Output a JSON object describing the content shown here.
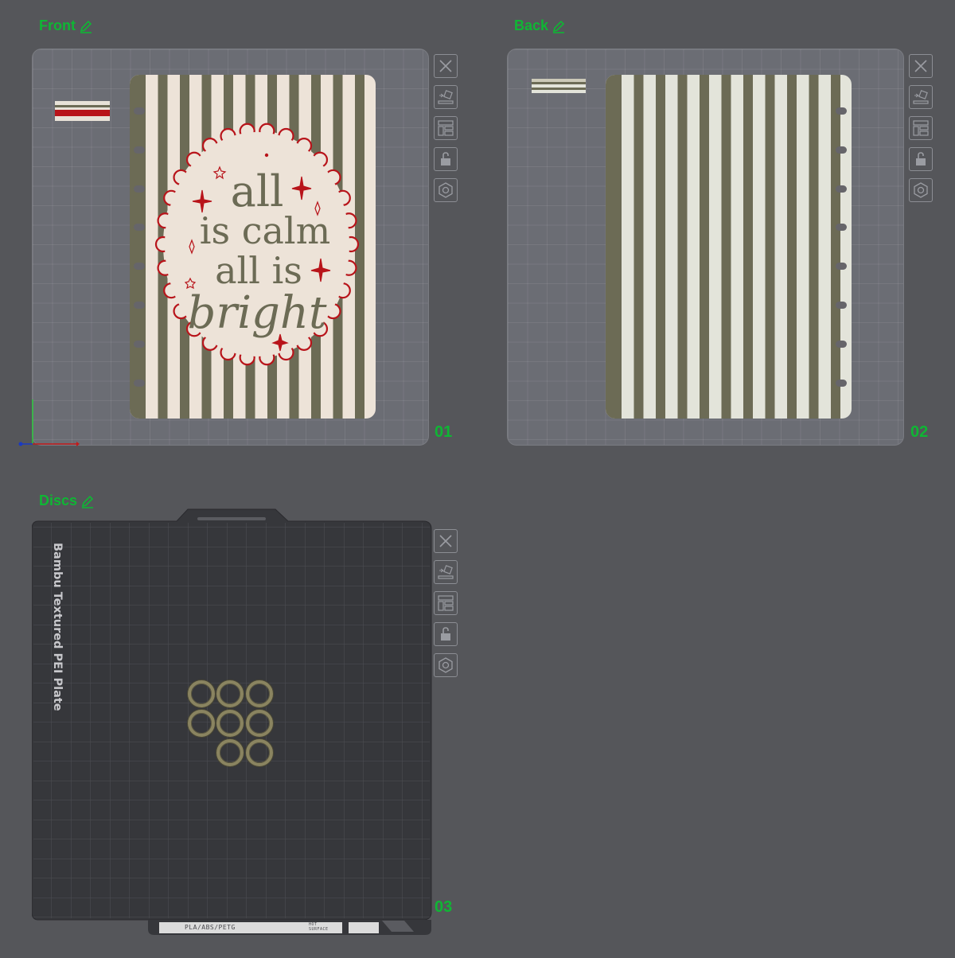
{
  "plates": [
    {
      "title": "Front",
      "number": "01"
    },
    {
      "title": "Back",
      "number": "02"
    },
    {
      "title": "Discs",
      "number": "03"
    }
  ],
  "front_text": {
    "line1": "all",
    "line2": "is calm",
    "line3": "all is",
    "line4": "bright"
  },
  "build_plate": {
    "name": "Bambu Textured PEI Plate",
    "materials": "PLA/ABS/PETG",
    "surface": "HOT SURFACE"
  },
  "toolbar_icons": [
    "close-icon",
    "auto-orient-icon",
    "arrange-icon",
    "lock-icon",
    "settings-icon"
  ],
  "colors": {
    "accent": "#0fb634",
    "stripe_dark": "#6c6b55",
    "stripe_light_front": "#ede3d8",
    "stripe_light_back": "#e3e4da",
    "red": "#b8141a",
    "disc": "#8a8460"
  }
}
